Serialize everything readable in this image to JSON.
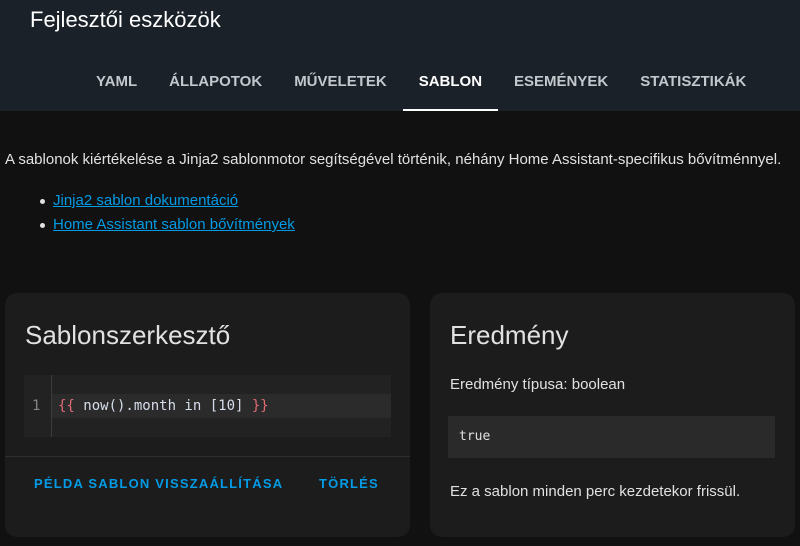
{
  "header": {
    "title": "Fejlesztői eszközök",
    "tabs": [
      {
        "label": "YAML",
        "active": false
      },
      {
        "label": "ÁLLAPOTOK",
        "active": false
      },
      {
        "label": "MŰVELETEK",
        "active": false
      },
      {
        "label": "SABLON",
        "active": true
      },
      {
        "label": "ESEMÉNYEK",
        "active": false
      },
      {
        "label": "STATISZTIKÁK",
        "active": false
      }
    ]
  },
  "intro": {
    "text": "A sablonok kiértékelése a Jinja2 sablonmotor segítségével történik, néhány Home Assistant-specifikus bővítménnyel.",
    "links": [
      {
        "label": "Jinja2 sablon dokumentáció"
      },
      {
        "label": "Home Assistant sablon bővítmények"
      }
    ]
  },
  "editor_card": {
    "title": "Sablonszerkesztő",
    "line_number": "1",
    "code": {
      "open": "{{",
      "body": " now().month in [10] ",
      "close": "}}"
    },
    "reset_button": "PÉLDA SABLON VISSZAÁLLÍTÁSA",
    "clear_button": "TÖRLÉS"
  },
  "result_card": {
    "title": "Eredmény",
    "type_line": "Eredmény típusa: boolean",
    "value": "true",
    "note": "Ez a sablon minden perc kezdetekor frissül."
  },
  "colors": {
    "background": "#111111",
    "header": "#1a2128",
    "card": "#1c1c1c",
    "accent": "#039be5",
    "template_brace": "#e06c75"
  }
}
